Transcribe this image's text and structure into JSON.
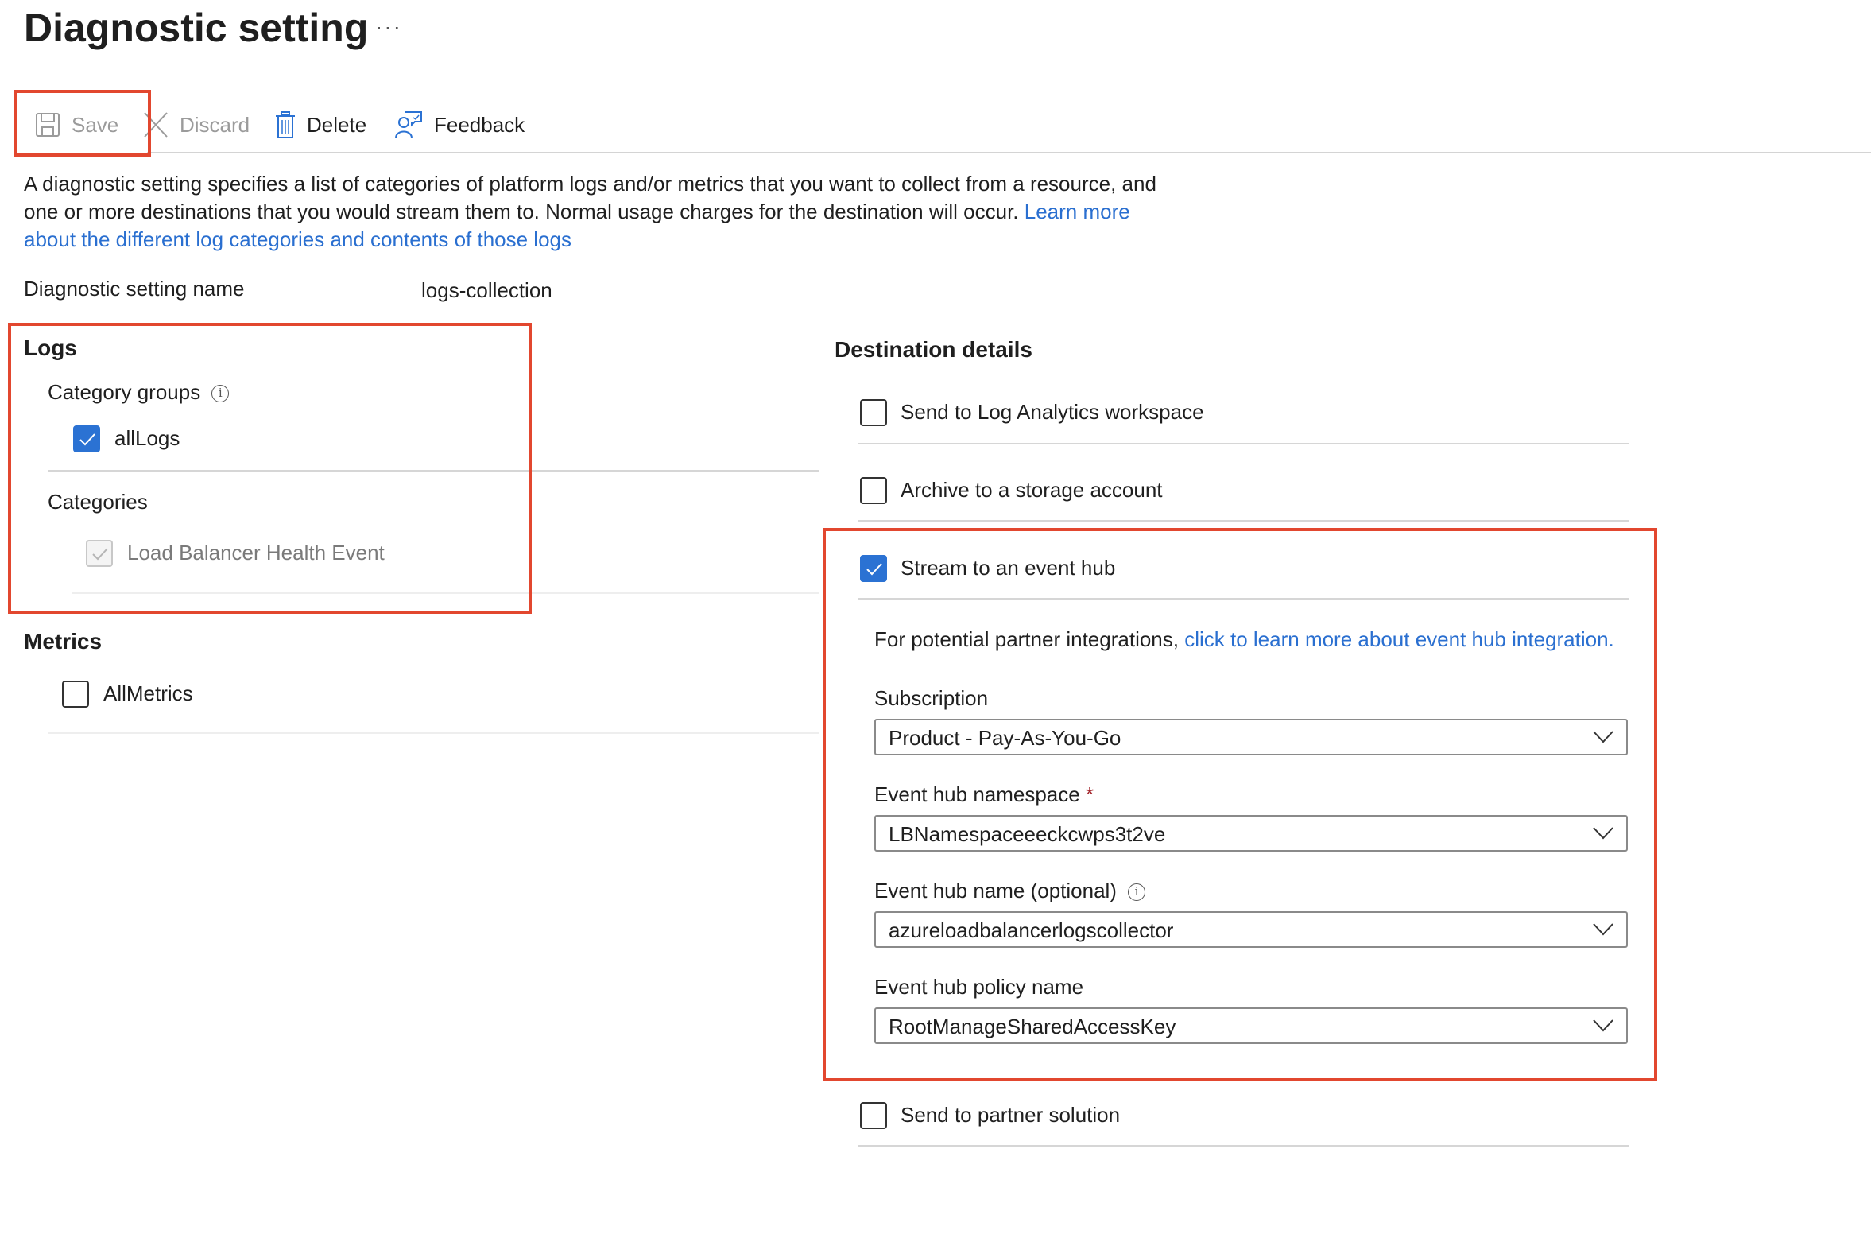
{
  "header": {
    "title": "Diagnostic setting",
    "more_label": "···"
  },
  "toolbar": {
    "save_label": "Save",
    "discard_label": "Discard",
    "delete_label": "Delete",
    "feedback_label": "Feedback"
  },
  "description": {
    "text": "A diagnostic setting specifies a list of categories of platform logs and/or metrics that you want to collect from a resource, and one or more destinations that you would stream them to. Normal usage charges for the destination will occur. ",
    "link": "Learn more about the different log categories and contents of those logs"
  },
  "setting_name": {
    "label": "Diagnostic setting name",
    "value": "logs-collection"
  },
  "logs": {
    "heading": "Logs",
    "category_groups_label": "Category groups",
    "category_groups": [
      {
        "label": "allLogs",
        "checked": true
      }
    ],
    "categories_label": "Categories",
    "categories": [
      {
        "label": "Load Balancer Health Event",
        "checked": true,
        "disabled": true
      }
    ]
  },
  "metrics": {
    "heading": "Metrics",
    "items": [
      {
        "label": "AllMetrics",
        "checked": false
      }
    ]
  },
  "destination": {
    "heading": "Destination details",
    "options": [
      {
        "label": "Send to Log Analytics workspace",
        "checked": false
      },
      {
        "label": "Archive to a storage account",
        "checked": false
      },
      {
        "label": "Stream to an event hub",
        "checked": true
      },
      {
        "label": "Send to partner solution",
        "checked": false
      }
    ],
    "event_hub": {
      "partner_text": "For potential partner integrations, ",
      "partner_link": "click to learn more about event hub integration.",
      "subscription_label": "Subscription",
      "subscription_value": "Product - Pay-As-You-Go",
      "namespace_label": "Event hub namespace",
      "namespace_required": "*",
      "namespace_value": "LBNamespaceeeckcwps3t2ve",
      "name_label": "Event hub name (optional)",
      "name_value": "azureloadbalancerlogscollector",
      "policy_label": "Event hub policy name",
      "policy_value": "RootManageSharedAccessKey"
    }
  },
  "colors": {
    "accent": "#2b72d3",
    "link": "#2a6fd0",
    "highlight": "#e2472f",
    "required": "#a4262c"
  }
}
